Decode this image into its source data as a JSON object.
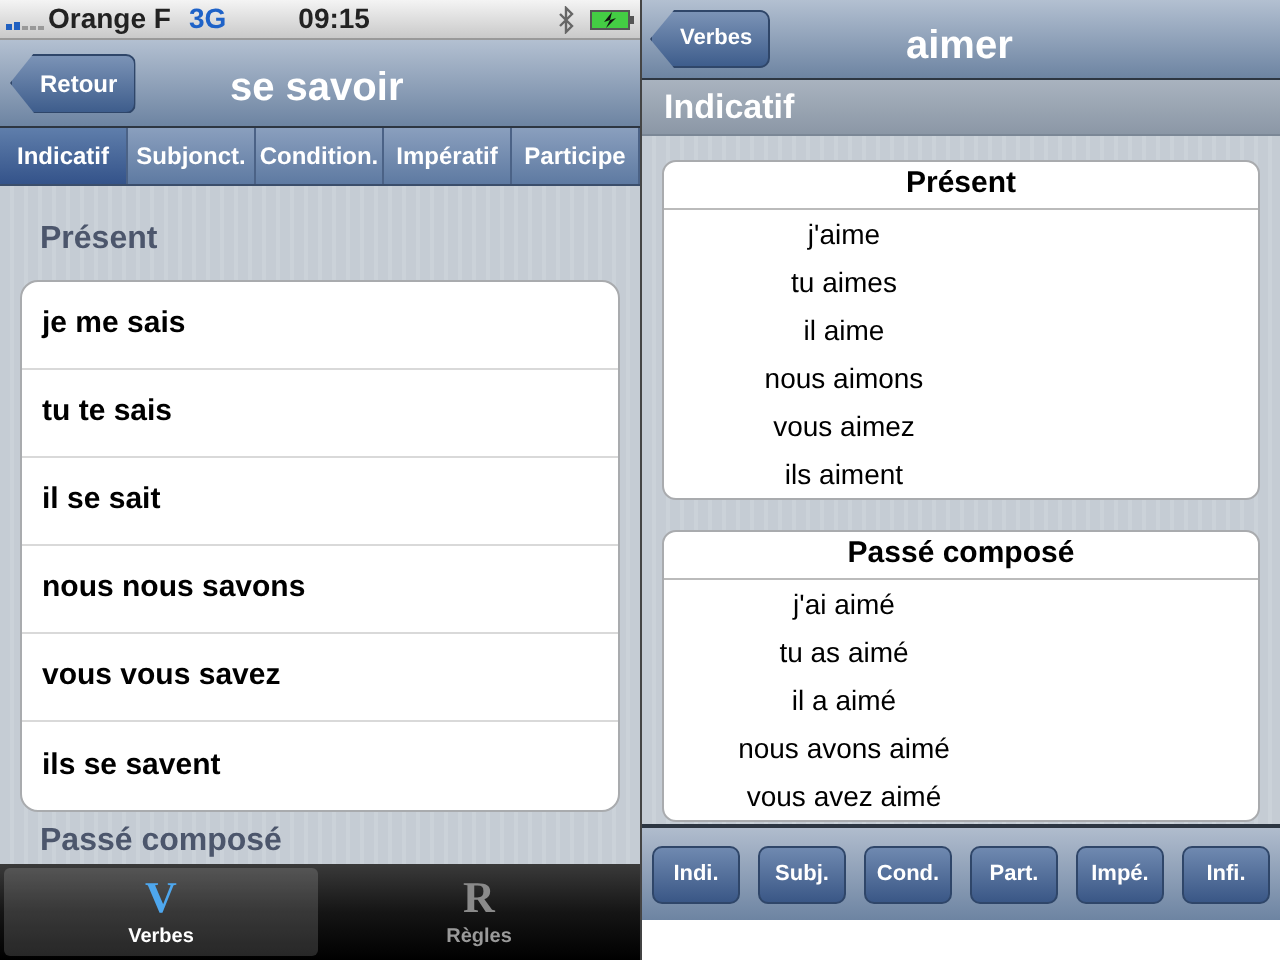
{
  "left_screen": {
    "status_bar": {
      "carrier": "Orange F",
      "network": "3G",
      "time": "09:15"
    },
    "nav_bar": {
      "back": "Retour",
      "title": "se savoir"
    },
    "tabs": [
      {
        "label": "Indicatif",
        "selected": true
      },
      {
        "label": "Subjonct.",
        "selected": false
      },
      {
        "label": "Condition.",
        "selected": false
      },
      {
        "label": "Impératif",
        "selected": false
      },
      {
        "label": "Participe",
        "selected": false
      }
    ],
    "sections": [
      {
        "title": "Présent",
        "rows": [
          "je me sais",
          "tu te sais",
          "il se sait",
          "nous nous savons",
          "vous vous savez",
          "ils se savent"
        ]
      },
      {
        "title": "Passé composé"
      }
    ],
    "tab_bar": [
      {
        "glyph": "V",
        "label": "Verbes",
        "selected": true
      },
      {
        "glyph": "R",
        "label": "Règles",
        "selected": false
      }
    ]
  },
  "right_screen": {
    "nav_bar": {
      "back": "Verbes",
      "title": "aimer"
    },
    "section_header": "Indicatif",
    "tables": [
      {
        "title": "Présent",
        "rows": [
          "j'aime",
          "tu aimes",
          "il aime",
          "nous aimons",
          "vous aimez",
          "ils aiment"
        ]
      },
      {
        "title": "Passé composé",
        "rows": [
          "j'ai aimé",
          "tu as aimé",
          "il a aimé",
          "nous avons aimé",
          "vous avez aimé"
        ]
      }
    ],
    "toolbar": [
      "Indi.",
      "Subj.",
      "Cond.",
      "Part.",
      "Impé.",
      "Infi."
    ]
  }
}
